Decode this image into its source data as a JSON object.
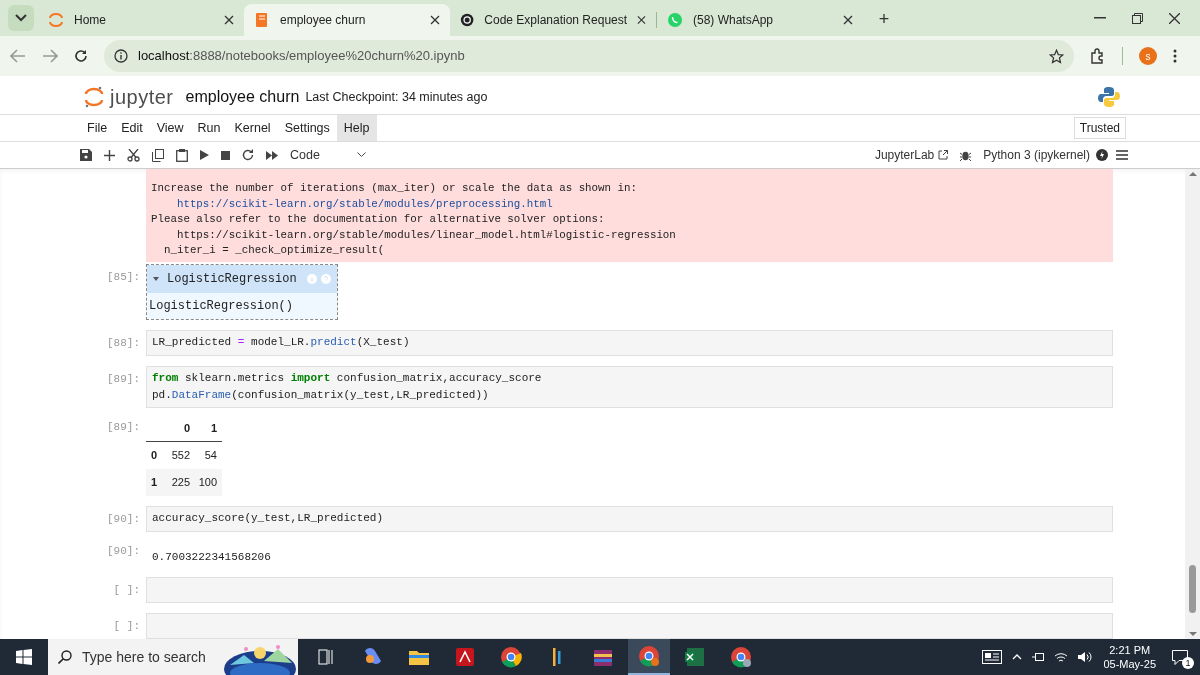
{
  "browser": {
    "tabs": [
      {
        "title": "Home",
        "selected": false
      },
      {
        "title": "employee churn",
        "selected": true
      },
      {
        "title": "Code Explanation Request",
        "selected": false
      },
      {
        "title": "(58) WhatsApp",
        "selected": false
      }
    ],
    "new_tab": "+",
    "url_host": "localhost",
    "url_path": ":8888/notebooks/employee%20churn%20.ipynb",
    "profile": "s"
  },
  "jupyter": {
    "logo_text": "jupyter",
    "notebook_title": "employee churn",
    "checkpoint": "Last Checkpoint: 34 minutes ago",
    "menu": [
      {
        "label": "File",
        "selected": false
      },
      {
        "label": "Edit",
        "selected": false
      },
      {
        "label": "View",
        "selected": false
      },
      {
        "label": "Run",
        "selected": false
      },
      {
        "label": "Kernel",
        "selected": false
      },
      {
        "label": "Settings",
        "selected": false
      },
      {
        "label": "Help",
        "selected": true
      }
    ],
    "trusted": "Trusted",
    "cell_type": "Code",
    "jupyterlab": "JupyterLab",
    "kernel": "Python 3 (ipykernel)"
  },
  "cells": [
    {
      "kind": "stderr",
      "lines": [
        {
          "text": "Increase the number of iterations (max_iter) or scale the data as shown in:",
          "link": false
        },
        {
          "text": "    https://scikit-learn.org/stable/modules/preprocessing.html",
          "link": true
        },
        {
          "text": "Please also refer to the documentation for alternative solver options:",
          "link": false
        },
        {
          "text": "    https://scikit-learn.org/stable/modules/linear_model.html#logistic-regression",
          "link": false
        },
        {
          "text": "  n_iter_i = _check_optimize_result(",
          "link": false
        }
      ]
    },
    {
      "kind": "estimator",
      "prompt": "[85]:",
      "title": "LogisticRegression",
      "body": "LogisticRegression()"
    },
    {
      "kind": "code",
      "prompt": "[88]:",
      "lines": [
        [
          {
            "t": "LR_predicted ",
            "kind": "name"
          },
          {
            "t": "=",
            "kind": "op"
          },
          {
            "t": " model_LR.",
            "kind": "name"
          },
          {
            "t": "predict",
            "kind": "attr"
          },
          {
            "t": "(X_test)",
            "kind": "name"
          }
        ]
      ]
    },
    {
      "kind": "code",
      "prompt": "[89]:",
      "lines": [
        [
          {
            "t": "from",
            "kind": "kw"
          },
          {
            "t": " sklearn.metrics ",
            "kind": "name"
          },
          {
            "t": "import",
            "kind": "kw"
          },
          {
            "t": " confusion_matrix,accuracy_score",
            "kind": "name"
          }
        ],
        [
          {
            "t": "pd.",
            "kind": "name"
          },
          {
            "t": "DataFrame",
            "kind": "attr"
          },
          {
            "t": "(confusion_matrix(y_test,LR_predicted))",
            "kind": "name"
          }
        ]
      ]
    },
    {
      "kind": "dataframe",
      "prompt": "[89]:",
      "columns": [
        "0",
        "1"
      ],
      "rows": [
        {
          "index": "0",
          "values": [
            "552",
            "54"
          ]
        },
        {
          "index": "1",
          "values": [
            "225",
            "100"
          ]
        }
      ]
    },
    {
      "kind": "code",
      "prompt": "[90]:",
      "lines": [
        [
          {
            "t": "accuracy_score(y_test,LR_predicted)",
            "kind": "name"
          }
        ]
      ]
    },
    {
      "kind": "result",
      "prompt": "[90]:",
      "text": "0.7003222341568206"
    },
    {
      "kind": "code",
      "prompt": "[ ]:"
    },
    {
      "kind": "code",
      "prompt": "[ ]:"
    }
  ],
  "taskbar": {
    "search_placeholder": "Type here to search",
    "time": "2:21 PM",
    "date": "05-May-25",
    "notifications": "1"
  }
}
